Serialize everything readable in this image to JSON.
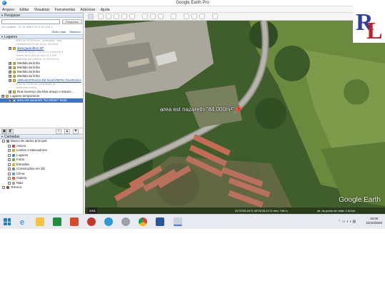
{
  "window": {
    "title": "Google Earth Pro"
  },
  "menu": {
    "items": [
      "Arquivo",
      "Editar",
      "Visualizar",
      "Ferramentas",
      "Adicionar",
      "Ajuda"
    ]
  },
  "search": {
    "header": "Pesquisar",
    "button": "Pesquisar",
    "history_line": "em análise - 41 91 398 3 00 8 15 5 00 1",
    "links": [
      "Obter rotas",
      "Histórico"
    ]
  },
  "places": {
    "header": "Lugares",
    "items": [
      {
        "type": "sub",
        "text": "AREA de 90,000m²m² - localização - está"
      },
      {
        "type": "sub",
        "text": "Levantamento Puras 100 pl. Rua área"
      },
      {
        "type": "folder",
        "text": "área guarulhos SP",
        "link": true,
        "checked": true
      },
      {
        "type": "sub",
        "text": "Terreno de 50.30 = 116,00 x 1,19 (90,00) ti"
      },
      {
        "type": "sub",
        "text": "Terreno de 10,500 de 2001 30 0 Sub"
      },
      {
        "type": "sub",
        "text": "localizado área área de 13.200,00m²m²"
      },
      {
        "type": "ruler",
        "text": "Medida da linha",
        "checked": true
      },
      {
        "type": "ruler",
        "text": "Medida da linha",
        "checked": true
      },
      {
        "type": "ruler",
        "text": "Medida da linha",
        "checked": true
      },
      {
        "type": "ruler",
        "text": "Medida da linha",
        "checked": true
      },
      {
        "type": "folder",
        "text": "AREAESTRADA DE NAZARETH GUARULH",
        "link": true,
        "checked": true
      },
      {
        "type": "sub",
        "text": "AREA de 9415m²m² composição de"
      },
      {
        "type": "sub",
        "text": "construção vertical - ..."
      },
      {
        "type": "folder",
        "text": "Rua lourenço da silva araujo e amazo...",
        "link": false,
        "checked": true
      },
      {
        "type": "temp",
        "text": "Lugares temporários",
        "checked": true
      },
      {
        "type": "poly",
        "text": "area est nazareth \"84.000m²\" fonte",
        "checked": true,
        "selected": true
      }
    ]
  },
  "layers": {
    "header": "Camadas",
    "items": [
      {
        "text": "Banco de dados principal",
        "color": "#7a7a7a",
        "indent": 0
      },
      {
        "text": "Avisos",
        "color": "#c04848",
        "indent": 1
      },
      {
        "text": "Limites e Marcadores",
        "color": "#d0a030",
        "indent": 1
      },
      {
        "text": "Lugares",
        "color": "#4a86d0",
        "indent": 1
      },
      {
        "text": "Fotos",
        "color": "#6aa84f",
        "indent": 1
      },
      {
        "text": "Estradas",
        "color": "#e0b020",
        "indent": 1
      },
      {
        "text": "Construções em 3D",
        "color": "#888888",
        "indent": 1
      },
      {
        "text": "Clima",
        "color": "#5aa0e0",
        "indent": 1
      },
      {
        "text": "Galeria",
        "color": "#e06030",
        "indent": 1
      },
      {
        "text": "Mais",
        "color": "#a0a0a0",
        "indent": 1
      },
      {
        "text": "Terreno",
        "color": "#7a5a3a",
        "indent": 0
      }
    ]
  },
  "map": {
    "placemark_label": "area est nazareth \"84.000m²\"",
    "watermark": "Google Earth",
    "status": {
      "coordinates": "23°23'50.24\"S   46°26'26.21\"O   elev.   746 m",
      "eye_alt": "alt. do ponto de visão   1.54 km",
      "scale": "2001"
    }
  },
  "taskbar": {
    "time": "16:00",
    "date": "22/10/2020"
  },
  "logo": {
    "text": "RL"
  }
}
